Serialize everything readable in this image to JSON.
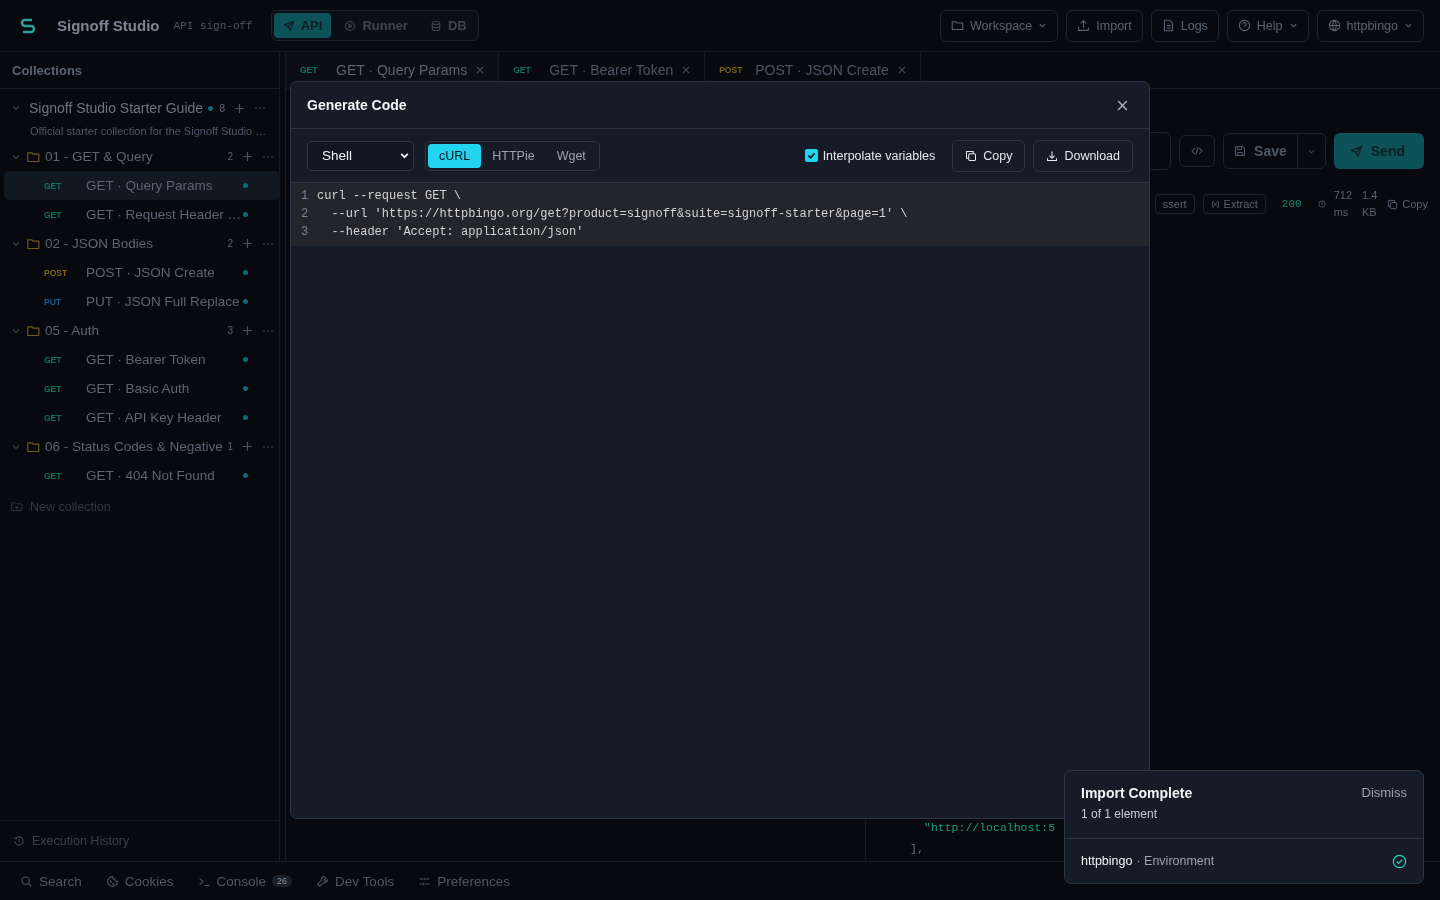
{
  "app": {
    "title": "Signoff Studio",
    "subtitle": "API sign-off"
  },
  "modes": [
    {
      "label": "API",
      "kind": "send",
      "selected": true
    },
    {
      "label": "Runner",
      "kind": "runner",
      "selected": false
    },
    {
      "label": "DB",
      "kind": "db",
      "selected": false
    }
  ],
  "top_buttons": [
    {
      "label": "Workspace",
      "kind": "folder",
      "dropdown": true
    },
    {
      "label": "Import",
      "kind": "upload",
      "dropdown": false
    },
    {
      "label": "Logs",
      "kind": "file",
      "dropdown": false
    },
    {
      "label": "Help",
      "kind": "help",
      "dropdown": true
    },
    {
      "label": "httpbingo",
      "kind": "globe",
      "dropdown": true
    }
  ],
  "sidebar": {
    "title": "Collections",
    "collections": [
      {
        "name": "Signoff Studio Starter Guide",
        "count": "8",
        "description": "Official starter collection for the Signoff Studio …",
        "expanded": true,
        "children": [
          {
            "name": "01 - GET & Query",
            "count": "2",
            "expanded": true,
            "children": [
              {
                "method": "GET",
                "color": "#10725e",
                "name": "GET · Query Params",
                "selected": true
              },
              {
                "method": "GET",
                "color": "#10725e",
                "name": "GET · Request Header …",
                "selected": false
              }
            ]
          },
          {
            "name": "02 - JSON Bodies",
            "count": "2",
            "expanded": true,
            "children": [
              {
                "method": "POST",
                "color": "#7a6410",
                "name": "POST · JSON Create",
                "selected": false
              },
              {
                "method": "PUT",
                "color": "#1d5a8a",
                "name": "PUT · JSON Full Replace",
                "selected": false
              }
            ]
          },
          {
            "name": "05 - Auth",
            "count": "3",
            "expanded": true,
            "children": [
              {
                "method": "GET",
                "color": "#10725e",
                "name": "GET · Bearer Token",
                "selected": false
              },
              {
                "method": "GET",
                "color": "#10725e",
                "name": "GET · Basic Auth",
                "selected": false
              },
              {
                "method": "GET",
                "color": "#10725e",
                "name": "GET · API Key Header",
                "selected": false
              }
            ]
          },
          {
            "name": "06 - Status Codes & Negative",
            "count": "1",
            "expanded": true,
            "children": [
              {
                "method": "GET",
                "color": "#10725e",
                "name": "GET · 404 Not Found",
                "selected": false
              }
            ]
          }
        ]
      }
    ],
    "new_collection": "New collection",
    "footer": "Execution History"
  },
  "tabs": [
    {
      "method": "GET",
      "color": "#10725e",
      "title": "GET · Query Params",
      "selected": true
    },
    {
      "method": "GET",
      "color": "#10725e",
      "title": "GET · Bearer Token",
      "selected": false
    },
    {
      "method": "POST",
      "color": "#7a6410",
      "title": "POST · JSON Create",
      "selected": false
    }
  ],
  "request_bar": {
    "save": "Save",
    "send": "Send"
  },
  "response_bar": {
    "tools": [
      {
        "label": "ssert",
        "kind": "assert"
      },
      {
        "label": "Extract",
        "kind": "extract"
      }
    ],
    "status": "200",
    "time": [
      "712",
      "ms"
    ],
    "size": [
      "1.4",
      "KB"
    ],
    "copy": "Copy"
  },
  "response_body": [
    "\"http://localhost:5",
    "],"
  ],
  "bottom_bar": [
    {
      "label": "Search",
      "kind": "search"
    },
    {
      "label": "Cookies",
      "kind": "cookie"
    },
    {
      "label": "Console",
      "kind": "console",
      "badge": "26"
    },
    {
      "label": "Dev Tools",
      "kind": "wrench"
    },
    {
      "label": "Preferences",
      "kind": "sliders"
    }
  ],
  "modal": {
    "title": "Generate Code",
    "language": "Shell",
    "variants": [
      {
        "label": "cURL",
        "selected": true
      },
      {
        "label": "HTTPie",
        "selected": false
      },
      {
        "label": "Wget",
        "selected": false
      }
    ],
    "interpolate": {
      "label": "Interpolate variables",
      "checked": true
    },
    "copy": "Copy",
    "download": "Download",
    "code": [
      {
        "number": "1",
        "text": "curl --request GET \\"
      },
      {
        "number": "2",
        "text": "  --url 'https://httpbingo.org/get?product=signoff&suite=signoff-starter&page=1' \\"
      },
      {
        "number": "3",
        "text": "  --header 'Accept: application/json'"
      }
    ]
  },
  "toast": {
    "title": "Import Complete",
    "dismiss": "Dismiss",
    "subtitle": "1 of 1 element",
    "item": {
      "name": "httpbingo",
      "detail": "· Environment",
      "done": true
    }
  }
}
